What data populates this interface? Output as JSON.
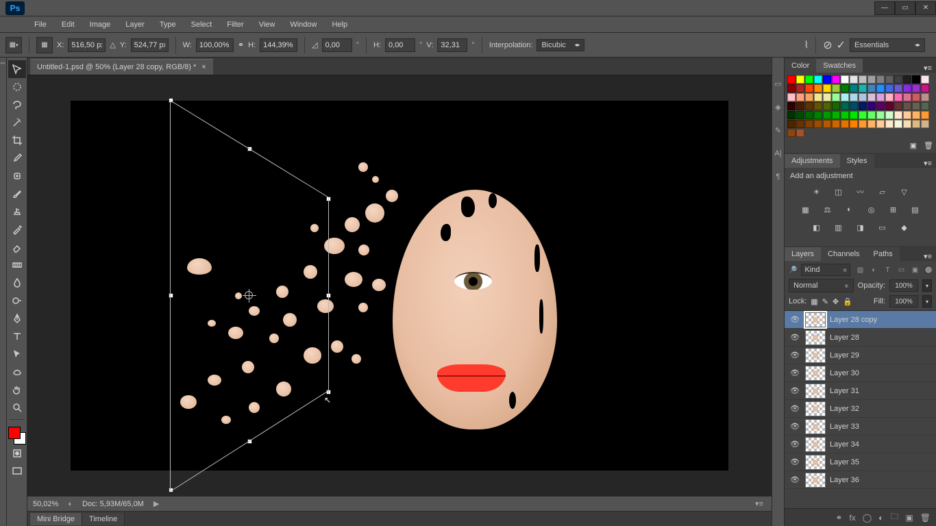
{
  "titlebar": {
    "app": "Ps",
    "min": "—",
    "max": "▭",
    "close": "✕"
  },
  "menu": [
    "File",
    "Edit",
    "Image",
    "Layer",
    "Type",
    "Select",
    "Filter",
    "View",
    "Window",
    "Help"
  ],
  "options": {
    "x_label": "X:",
    "x_value": "516,50 px",
    "y_label": "Y:",
    "y_value": "524,77 px",
    "w_label": "W:",
    "w_value": "100,00%",
    "h_label": "H:",
    "h_value": "144,39%",
    "angle_label": "",
    "angle_value": "0,00",
    "skew_h_label": "H:",
    "skew_h_value": "0,00",
    "skew_v_label": "V:",
    "skew_v_value": "32,31",
    "interp_label": "Interpolation:",
    "interp_value": "Bicubic",
    "workspace": "Essentials"
  },
  "doc_tab": {
    "title": "Untitled-1.psd @ 50% (Layer 28 copy, RGB/8) *",
    "close": "×"
  },
  "status": {
    "zoom": "50,02%",
    "doc": "Doc: 5,93M/65,0M"
  },
  "bottom_tabs": [
    "Mini Bridge",
    "Timeline"
  ],
  "swatches_tabs": [
    "Color",
    "Swatches"
  ],
  "adjustments_tabs": [
    "Adjustments",
    "Styles"
  ],
  "adjustments_title": "Add an adjustment",
  "layers_tabs": [
    "Layers",
    "Channels",
    "Paths"
  ],
  "layers_head": {
    "kind_label": "Kind",
    "blend": "Normal",
    "opacity_label": "Opacity:",
    "opacity_value": "100%",
    "lock_label": "Lock:",
    "fill_label": "Fill:",
    "fill_value": "100%"
  },
  "layers": [
    {
      "name": "Layer 28 copy",
      "selected": true
    },
    {
      "name": "Layer 28"
    },
    {
      "name": "Layer 29"
    },
    {
      "name": "Layer 30"
    },
    {
      "name": "Layer 31"
    },
    {
      "name": "Layer 32"
    },
    {
      "name": "Layer 33"
    },
    {
      "name": "Layer 34"
    },
    {
      "name": "Layer 35"
    },
    {
      "name": "Layer 36"
    }
  ],
  "swatch_colors": [
    "#ff0000",
    "#ffff00",
    "#00ff00",
    "#00ffff",
    "#0000ff",
    "#ff00ff",
    "#ffffff",
    "#e4e4e4",
    "#c0c0c0",
    "#a0a0a0",
    "#808080",
    "#606060",
    "#404040",
    "#202020",
    "#000000",
    "#fee6e6",
    "#8b0000",
    "#b22222",
    "#ff4500",
    "#ff8c00",
    "#ffd700",
    "#9acd32",
    "#008000",
    "#008080",
    "#20b2aa",
    "#4682b4",
    "#1e90ff",
    "#4169e1",
    "#6a5acd",
    "#8a2be2",
    "#9932cc",
    "#c71585",
    "#ffc0cb",
    "#ffa07a",
    "#f4a460",
    "#f0e68c",
    "#eee8aa",
    "#98fb98",
    "#afeeee",
    "#add8e6",
    "#b0c4de",
    "#d8bfd8",
    "#dda0dd",
    "#ffb6c1",
    "#ff69b4",
    "#db7093",
    "#cd5c5c",
    "#bc8f8f",
    "#2e0000",
    "#4a1a00",
    "#5c3300",
    "#665200",
    "#4d6600",
    "#1a6600",
    "#00664d",
    "#004d66",
    "#001a66",
    "#33007a",
    "#5c0066",
    "#660033",
    "#663333",
    "#66524d",
    "#666052",
    "#526652",
    "#003300",
    "#004d00",
    "#006600",
    "#008000",
    "#009900",
    "#00b300",
    "#00cc00",
    "#00e600",
    "#33ff33",
    "#66ff66",
    "#99ff99",
    "#ccffcc",
    "#ffe6cc",
    "#ffcc99",
    "#ffb366",
    "#ff9933",
    "#4d2600",
    "#663300",
    "#804000",
    "#994d00",
    "#b35900",
    "#cc6600",
    "#e67300",
    "#ff8000",
    "#ff9933",
    "#ffb366",
    "#ffcc99",
    "#ffe6cc",
    "#f5f5dc",
    "#f5deb3",
    "#deb887",
    "#d2b48c",
    "#8b4513",
    "#a0522d"
  ]
}
